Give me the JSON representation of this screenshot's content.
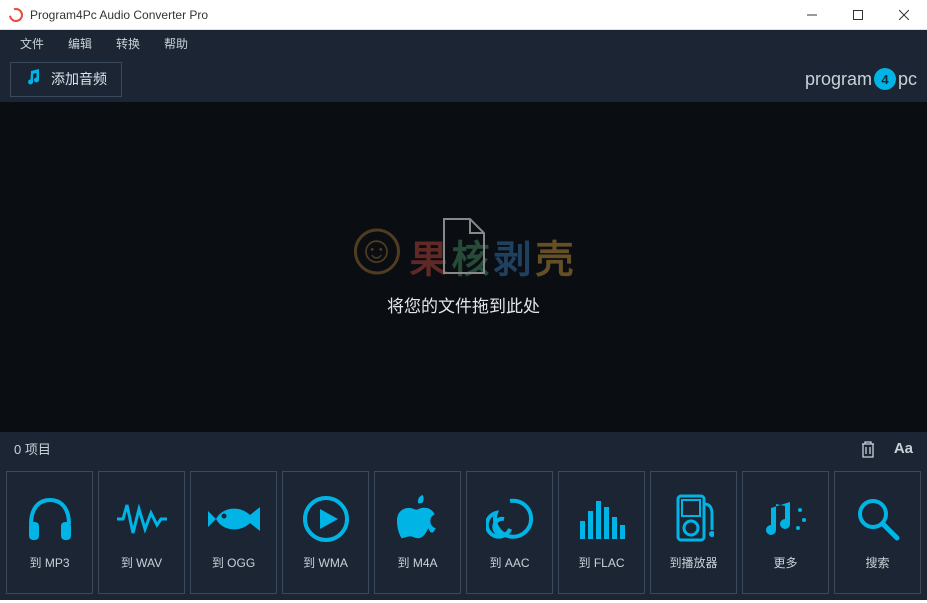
{
  "window": {
    "title": "Program4Pc Audio Converter Pro"
  },
  "menu": {
    "file": "文件",
    "edit": "编辑",
    "convert": "转换",
    "help": "帮助"
  },
  "toolbar": {
    "add_audio": "添加音频",
    "brand_pre": "program",
    "brand_num": "4",
    "brand_post": "pc"
  },
  "dropzone": {
    "text": "将您的文件拖到此处"
  },
  "watermark": {
    "c1": "果",
    "c2": "核",
    "c3": "剥",
    "c4": "壳"
  },
  "status": {
    "count_label": "0 项目"
  },
  "formats": {
    "mp3": "到 MP3",
    "wav": "到 WAV",
    "ogg": "到 OGG",
    "wma": "到 WMA",
    "m4a": "到 M4A",
    "aac": "到 AAC",
    "flac": "到 FLAC",
    "player": "到播放器",
    "more": "更多",
    "search": "搜索"
  }
}
